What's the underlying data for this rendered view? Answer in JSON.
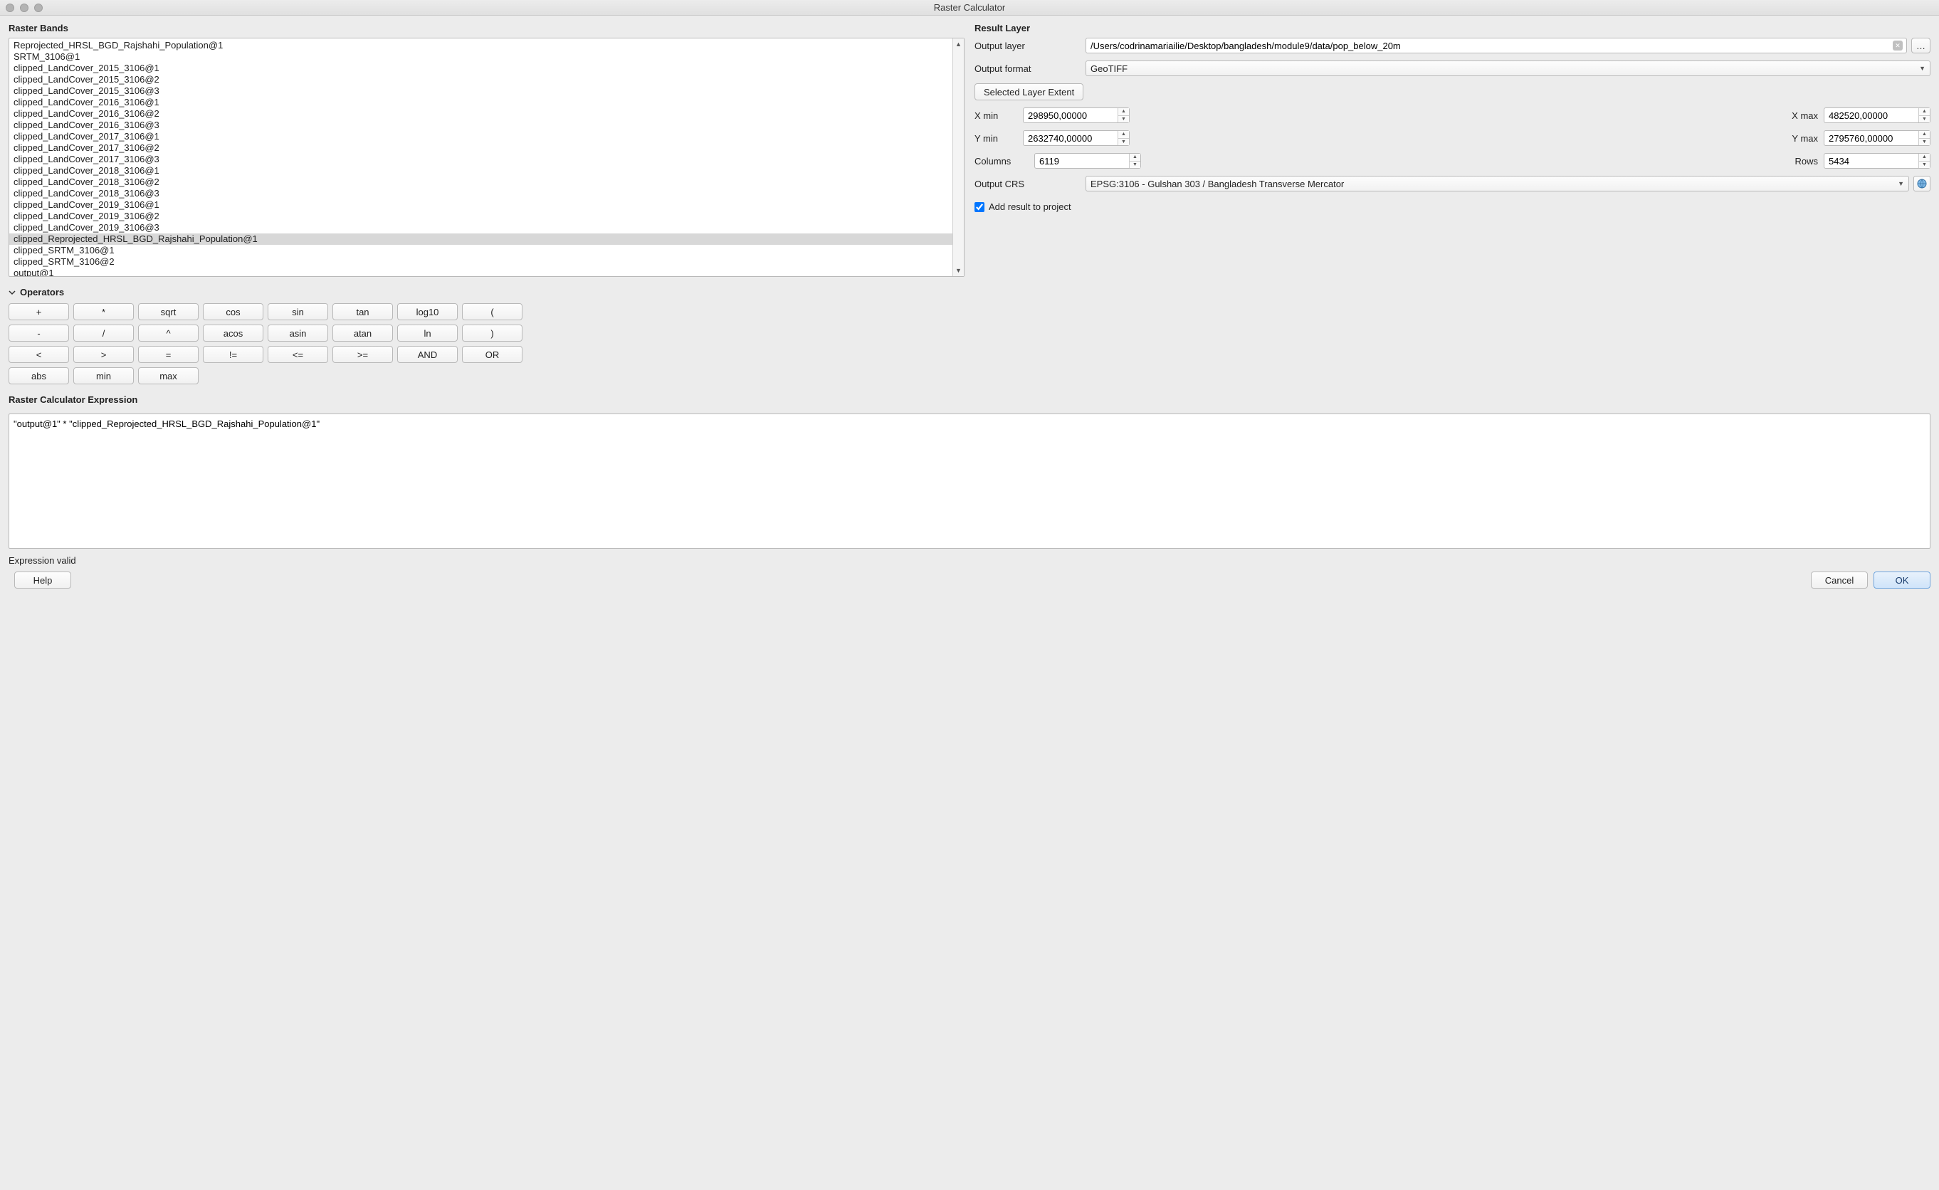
{
  "title": "Raster Calculator",
  "sections": {
    "bands_label": "Raster Bands",
    "result_label": "Result Layer",
    "operators_label": "Operators",
    "expression_label": "Raster Calculator Expression"
  },
  "bands": [
    "Reprojected_HRSL_BGD_Rajshahi_Population@1",
    "SRTM_3106@1",
    "clipped_LandCover_2015_3106@1",
    "clipped_LandCover_2015_3106@2",
    "clipped_LandCover_2015_3106@3",
    "clipped_LandCover_2016_3106@1",
    "clipped_LandCover_2016_3106@2",
    "clipped_LandCover_2016_3106@3",
    "clipped_LandCover_2017_3106@1",
    "clipped_LandCover_2017_3106@2",
    "clipped_LandCover_2017_3106@3",
    "clipped_LandCover_2018_3106@1",
    "clipped_LandCover_2018_3106@2",
    "clipped_LandCover_2018_3106@3",
    "clipped_LandCover_2019_3106@1",
    "clipped_LandCover_2019_3106@2",
    "clipped_LandCover_2019_3106@3",
    "clipped_Reprojected_HRSL_BGD_Rajshahi_Population@1",
    "clipped_SRTM_3106@1",
    "clipped_SRTM_3106@2",
    "output@1"
  ],
  "bands_selected_index": 17,
  "result": {
    "output_layer_label": "Output layer",
    "output_layer_value": "/Users/codrinamariailie/Desktop/bangladesh/module9/data/pop_below_20m",
    "browse_label": "…",
    "output_format_label": "Output format",
    "output_format_value": "GeoTIFF",
    "extent_button": "Selected Layer Extent",
    "xmin_label": "X min",
    "xmin_value": "298950,00000",
    "xmax_label": "X max",
    "xmax_value": "482520,00000",
    "ymin_label": "Y min",
    "ymin_value": "2632740,00000",
    "ymax_label": "Y max",
    "ymax_value": "2795760,00000",
    "columns_label": "Columns",
    "columns_value": "6119",
    "rows_label": "Rows",
    "rows_value": "5434",
    "crs_label": "Output CRS",
    "crs_value": "EPSG:3106 - Gulshan 303 / Bangladesh Transverse Mercator",
    "add_result_label": "Add result to project",
    "add_result_checked": true
  },
  "operators": [
    "+",
    "*",
    "sqrt",
    "cos",
    "sin",
    "tan",
    "log10",
    "(",
    "-",
    "/",
    "^",
    "acos",
    "asin",
    "atan",
    "ln",
    ")",
    "<",
    ">",
    "=",
    "!=",
    "<=",
    ">=",
    "AND",
    "OR",
    "abs",
    "min",
    "max"
  ],
  "expression": "\"output@1\" * \"clipped_Reprojected_HRSL_BGD_Rajshahi_Population@1\"",
  "status": "Expression valid",
  "footer": {
    "help": "Help",
    "cancel": "Cancel",
    "ok": "OK"
  }
}
